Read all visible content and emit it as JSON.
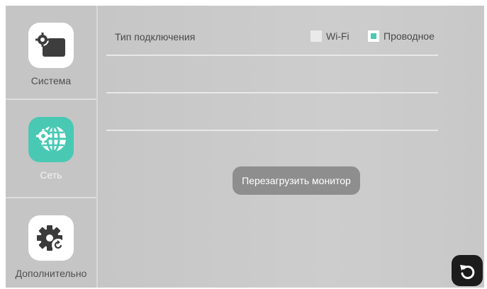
{
  "sidebar": {
    "items": [
      {
        "label": "Система",
        "icon": "system-settings-icon",
        "active": false
      },
      {
        "label": "Сеть",
        "icon": "network-globe-gear-icon",
        "active": true
      },
      {
        "label": "Дополнительно",
        "icon": "advanced-gear-refresh-icon",
        "active": false
      }
    ]
  },
  "main": {
    "connection_type_label": "Тип подключения",
    "options": [
      {
        "label": "Wi-Fi",
        "checked": false
      },
      {
        "label": "Проводное",
        "checked": true
      }
    ],
    "reboot_button_label": "Перезагрузить монитор",
    "back_icon": "back-arrow-icon"
  },
  "colors": {
    "accent": "#49c9b4",
    "background": "#c9c9c9",
    "button": "#8e8e8e",
    "back_button": "#1c1c1c"
  }
}
